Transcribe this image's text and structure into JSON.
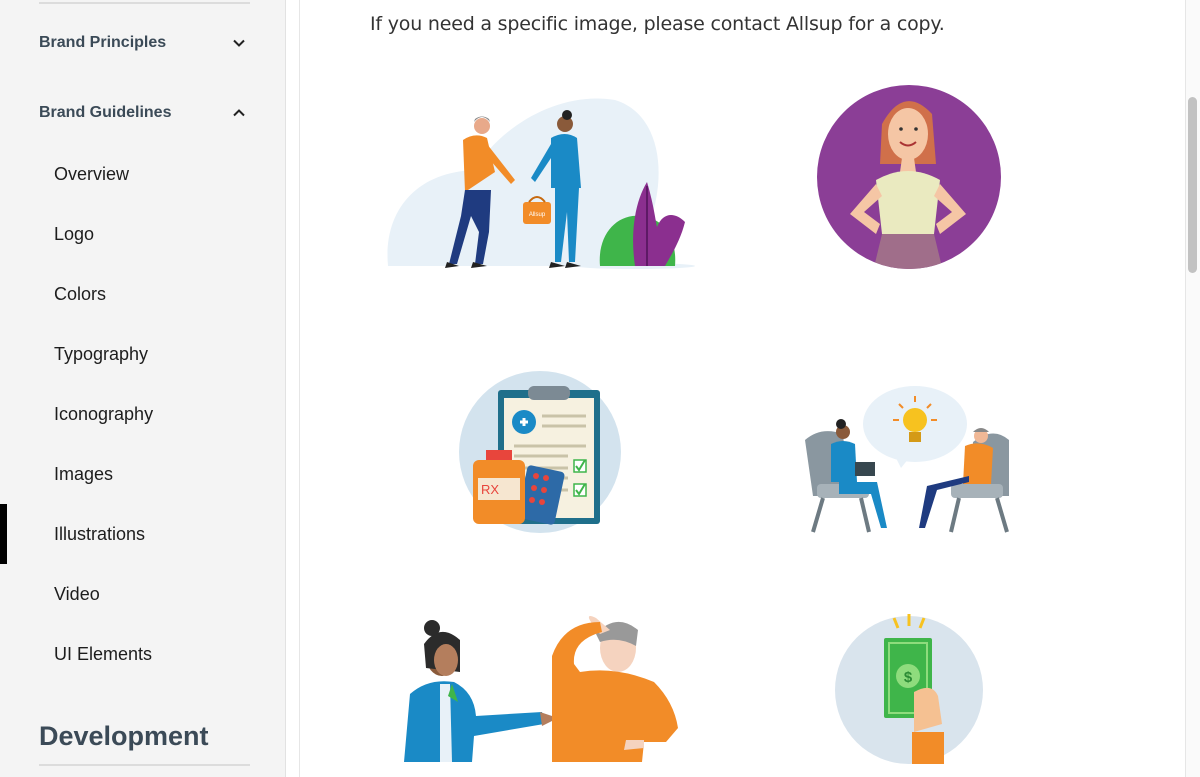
{
  "sidebar": {
    "brand_principles": "Brand Principles",
    "brand_guidelines": "Brand Guidelines",
    "items": [
      {
        "label": "Overview"
      },
      {
        "label": "Logo"
      },
      {
        "label": "Colors"
      },
      {
        "label": "Typography"
      },
      {
        "label": "Iconography"
      },
      {
        "label": "Images"
      },
      {
        "label": "Illustrations"
      },
      {
        "label": "Video"
      },
      {
        "label": "UI Elements"
      }
    ],
    "active_item": "Illustrations",
    "development": "Development"
  },
  "main": {
    "intro": "If you need a specific image, please contact Allsup for a copy.",
    "illustrations": [
      {
        "icon": "handshake-illustration",
        "bag_text": "Allsup"
      },
      {
        "icon": "woman-portrait-illustration"
      },
      {
        "icon": "prescription-clipboard-illustration",
        "bottle_text": "RX"
      },
      {
        "icon": "consultation-idea-illustration"
      },
      {
        "icon": "conversation-confused-illustration"
      },
      {
        "icon": "money-in-hand-illustration",
        "bill_symbol": "$"
      }
    ]
  },
  "colors": {
    "sidebar_bg": "#f4f4f4",
    "heading": "#3b4a57",
    "active_marker": "#000000",
    "orange": "#f28c28",
    "blue": "#1a8ac6",
    "purple": "#8b3e96",
    "green": "#3fb54a",
    "navy": "#1f3b80"
  }
}
